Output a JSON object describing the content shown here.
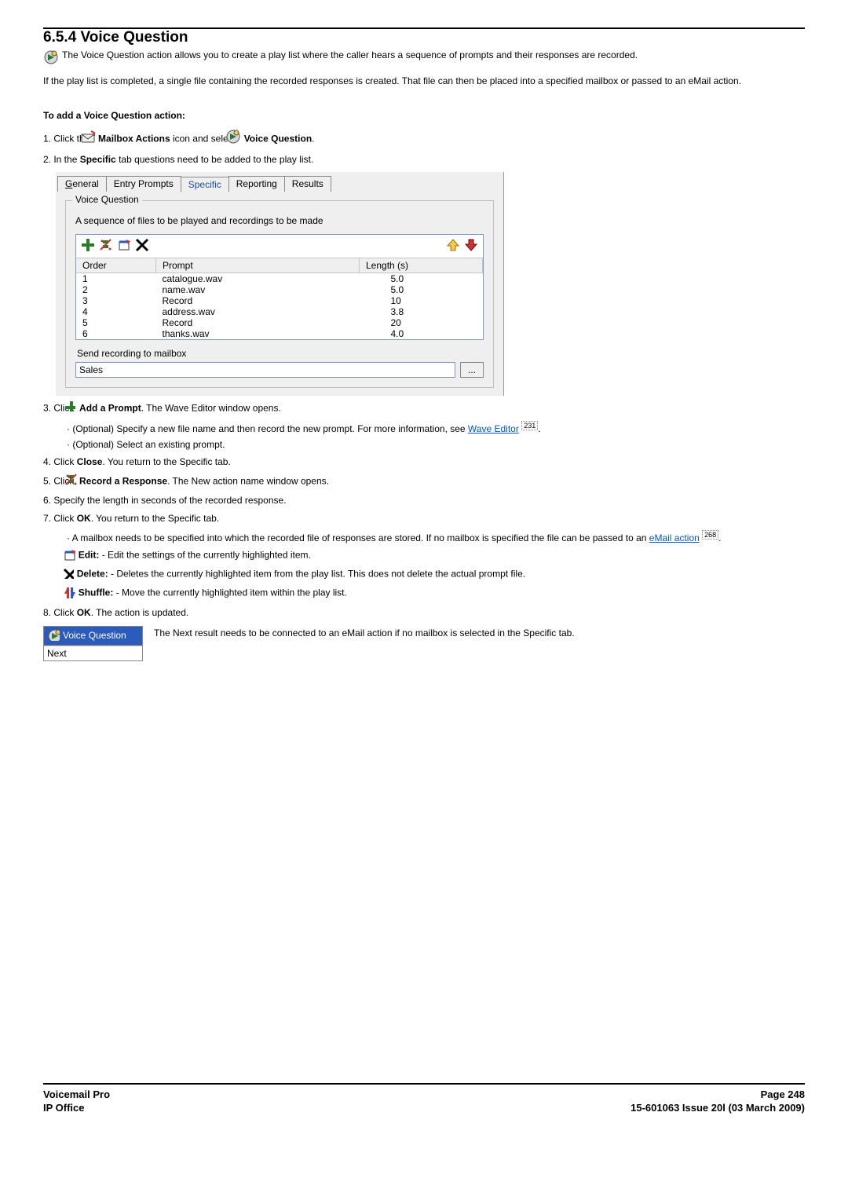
{
  "section_number_title": "6.5.4 Voice Question",
  "intro_p1": "The Voice Question action allows you to create a play list where the caller hears a sequence of prompts and their responses are recorded.",
  "intro_p2": "If the play list is completed, a single file containing the recorded responses is created. That file can then be placed into a specified mailbox or passed to an eMail action.",
  "to_add_heading": "To add a Voice Question action:",
  "step1_pre": "Click the ",
  "step1_bold1": "Mailbox Actions",
  "step1_mid": " icon and select ",
  "step1_bold2": "Voice Question",
  "step1_post": ".",
  "step2_pre": "In the ",
  "step2_bold": "Specific",
  "step2_post": " tab questions need to be added to the play list.",
  "tabs": {
    "general": "General",
    "entry": "Entry Prompts",
    "specific": "Specific",
    "reporting": "Reporting",
    "results": "Results"
  },
  "groupbox_legend": "Voice Question",
  "groupbox_desc": "A sequence of files to be played and recordings to be made",
  "headers": {
    "order": "Order",
    "prompt": "Prompt",
    "length": "Length (s)"
  },
  "rows": [
    {
      "order": "1",
      "prompt": "catalogue.wav",
      "length": "5.0"
    },
    {
      "order": "2",
      "prompt": "name.wav",
      "length": "5.0"
    },
    {
      "order": "3",
      "prompt": "Record",
      "length": "10"
    },
    {
      "order": "4",
      "prompt": "address.wav",
      "length": "3.8"
    },
    {
      "order": "5",
      "prompt": "Record",
      "length": "20"
    },
    {
      "order": "6",
      "prompt": "thanks.wav",
      "length": "4.0"
    }
  ],
  "send_label": "Send recording to mailbox",
  "send_value": "Sales",
  "browse_label": "...",
  "step3_pre": "Click ",
  "step3_bold": "Add a Prompt",
  "step3_post": ". The Wave Editor window opens.",
  "step3_sub1_pre": "(Optional) Specify a new file name and then record the new prompt. For more information, see ",
  "step3_sub1_link": "Wave Editor",
  "step3_sub1_ref": "231",
  "step3_sub1_post": ".",
  "step3_sub2": "(Optional) Select an existing prompt.",
  "step4_pre": "Click ",
  "step4_bold": "Close",
  "step4_post": ". You return to the Specific tab.",
  "step5_pre": "Click ",
  "step5_bold": "Record a Response",
  "step5_post": ". The New action name window opens.",
  "step6": "Specify the length in seconds of the recorded response.",
  "step7_pre": "Click ",
  "step7_bold": "OK",
  "step7_post": ". You return to the Specific tab.",
  "step7_sub1_pre": "A mailbox needs to be specified into which the recorded file of responses are stored. If no mailbox is specified the file can be passed to an ",
  "step7_sub1_link": "eMail action",
  "step7_sub1_ref": "268",
  "step7_sub1_post": ".",
  "edit_label": "Edit:",
  "edit_text": " - Edit the settings of the currently highlighted item.",
  "delete_label": "Delete:",
  "delete_text": " - Deletes the currently highlighted item from the play list. This does not delete the actual prompt file.",
  "shuffle_label": "Shuffle:",
  "shuffle_text": " - Move the currently highlighted item within the play list.",
  "step8_pre": "Click ",
  "step8_bold": "OK",
  "step8_post": ". The action is updated.",
  "result_header": "Voice Question",
  "result_row": "Next",
  "result_text": "The Next result needs to be connected to an eMail action if no mailbox is selected in the Specific tab.",
  "footer_left_1": "Voicemail Pro",
  "footer_left_2": "IP Office",
  "footer_right_1": "Page 248",
  "footer_right_2": "15-601063 Issue 20l (03 March 2009)"
}
